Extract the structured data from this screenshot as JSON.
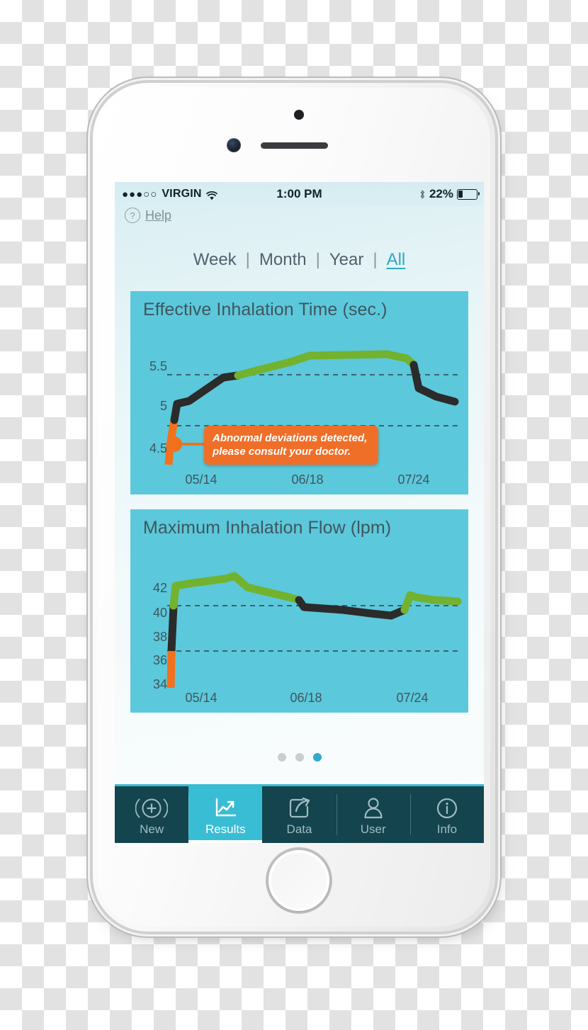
{
  "status_bar": {
    "signal_dots": "●●●○○",
    "carrier": "VIRGIN",
    "wifi_icon": "wifi-icon",
    "time": "1:00 PM",
    "bluetooth_icon": "bluetooth-icon",
    "battery_percent": "22%",
    "battery_level": 22
  },
  "help": {
    "icon": "question-mark-icon",
    "label": "Help"
  },
  "period_selector": {
    "separator": "|",
    "items": [
      {
        "label": "Week",
        "active": false
      },
      {
        "label": "Month",
        "active": false
      },
      {
        "label": "Year",
        "active": false
      },
      {
        "label": "All",
        "active": true
      }
    ]
  },
  "tooltip": {
    "line1": "Abnormal deviations detected,",
    "line2": "please consult your doctor."
  },
  "page_dots": {
    "count": 3,
    "active_index": 2
  },
  "tab_bar": {
    "items": [
      {
        "label": "New",
        "icon": "plus-circle-icon",
        "active": false
      },
      {
        "label": "Results",
        "icon": "line-chart-icon",
        "active": true
      },
      {
        "label": "Data",
        "icon": "share-export-icon",
        "active": false
      },
      {
        "label": "User",
        "icon": "person-icon",
        "active": false
      },
      {
        "label": "Info",
        "icon": "info-circle-icon",
        "active": false
      }
    ]
  },
  "colors": {
    "chart_background": "#5cc8db",
    "line_green": "#72b22f",
    "line_dark": "#2b2b2b",
    "line_orange": "#f2711c",
    "tooltip_orange": "#ef6f29",
    "accent_teal": "#2eaccb",
    "tab_bar_dark": "#14444e",
    "text_dark_slate": "#3f565e"
  },
  "chart_data": [
    {
      "id": "effective-inhalation-time",
      "type": "line",
      "title": "Effective Inhalation Time (sec.)",
      "xlabel": "",
      "ylabel": "",
      "ylim": [
        4.25,
        5.75
      ],
      "yticks": [
        "5.5",
        "5",
        "4.5"
      ],
      "ytick_values": [
        5.5,
        5.0,
        4.5
      ],
      "xticks": [
        "05/14",
        "06/18",
        "07/24"
      ],
      "grid": "dashed-horizontal",
      "reference_lines": [
        5.35,
        4.72
      ],
      "series": [
        {
          "name": "Effective inhalation time",
          "x": [
            0,
            1,
            2,
            3,
            4,
            5,
            6,
            7,
            8,
            9,
            10,
            11,
            12,
            13
          ],
          "values": [
            4.38,
            4.55,
            4.94,
            5.02,
            5.17,
            5.35,
            5.41,
            5.52,
            5.55,
            5.56,
            5.55,
            5.52,
            5.12,
            5.03
          ],
          "segment_colors": [
            "orange",
            "orange",
            "dark",
            "dark",
            "dark",
            "dark",
            "green",
            "green",
            "green",
            "green",
            "green",
            "green",
            "dark",
            "dark"
          ]
        }
      ],
      "marker": {
        "x_index": 1,
        "y": 4.52,
        "color": "#f2711c",
        "label": "abnormal-deviation-marker"
      },
      "annotation": "Abnormal deviations detected, please consult your doctor."
    },
    {
      "id": "maximum-inhalation-flow",
      "type": "line",
      "title": "Maximum Inhalation Flow (lpm)",
      "xlabel": "",
      "ylabel": "",
      "ylim": [
        33,
        43.5
      ],
      "yticks": [
        "42",
        "40",
        "38",
        "36",
        "34"
      ],
      "ytick_values": [
        42,
        40,
        38,
        36,
        34
      ],
      "xticks": [
        "05/14",
        "06/18",
        "07/24"
      ],
      "grid": "dashed-horizontal",
      "reference_lines": [
        41.3,
        36.5
      ],
      "series": [
        {
          "name": "Maximum inhalation flow",
          "x": [
            0,
            1,
            2,
            3,
            4,
            5,
            6,
            7,
            8,
            9,
            10,
            11,
            12,
            13
          ],
          "values": [
            33.4,
            36.5,
            41.3,
            42.6,
            42.7,
            42.9,
            42.2,
            41.8,
            41.5,
            41.2,
            41.0,
            40.8,
            42.0,
            41.7
          ],
          "segment_colors": [
            "orange",
            "orange",
            "dark",
            "green",
            "green",
            "green",
            "green",
            "green",
            "dark",
            "dark",
            "dark",
            "dark",
            "green",
            "green"
          ]
        }
      ]
    }
  ]
}
